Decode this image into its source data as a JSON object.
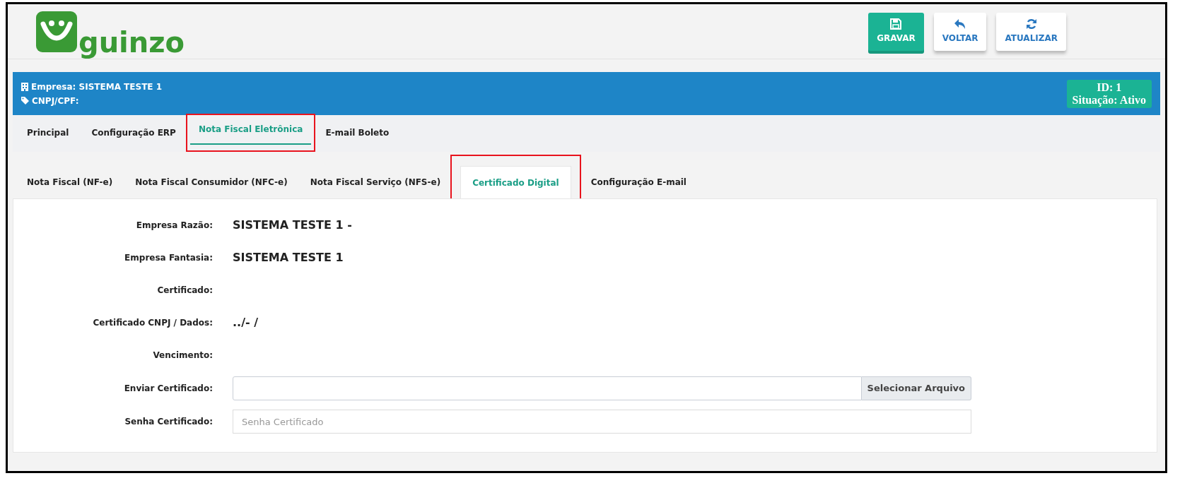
{
  "logo": {
    "text": "guinzo"
  },
  "toolbar": [
    {
      "label": "GRAVAR",
      "kind": "primary"
    },
    {
      "label": "VOLTAR",
      "kind": "default"
    },
    {
      "label": "ATUALIZAR",
      "kind": "default"
    }
  ],
  "company_bar": {
    "company": "Empresa: SISTEMA TESTE 1",
    "cnpj": "CNPJ/CPF:",
    "id": "ID: 1",
    "status": "Situação: Ativo"
  },
  "tabs": [
    {
      "label": "Principal",
      "selected": false,
      "highlighted": false
    },
    {
      "label": "Configuração ERP",
      "selected": false,
      "highlighted": false
    },
    {
      "label": "Nota Fiscal Eletrônica",
      "selected": true,
      "highlighted": true
    },
    {
      "label": "E-mail Boleto",
      "selected": false,
      "highlighted": false
    }
  ],
  "subtabs": [
    {
      "label": "Nota Fiscal (NF-e)",
      "selected": false,
      "highlighted": false
    },
    {
      "label": "Nota Fiscal Consumidor (NFC-e)",
      "selected": false,
      "highlighted": false
    },
    {
      "label": "Nota Fiscal Serviço (NFS-e)",
      "selected": false,
      "highlighted": false
    },
    {
      "label": "Certificado Digital",
      "selected": true,
      "highlighted": true
    },
    {
      "label": "Configuração E-mail",
      "selected": false,
      "highlighted": false
    }
  ],
  "form": [
    {
      "kind": "text",
      "label": "Empresa Razão:",
      "value": "SISTEMA TESTE 1 -"
    },
    {
      "kind": "text",
      "label": "Empresa Fantasia:",
      "value": "SISTEMA TESTE 1"
    },
    {
      "kind": "text",
      "label": "Certificado:"
    },
    {
      "kind": "text",
      "label": "Certificado CNPJ / Dados:",
      "value": "../- /"
    },
    {
      "kind": "text",
      "label": "Vencimento:"
    },
    {
      "kind": "file",
      "label": "Enviar Certificado:",
      "button": "Selecionar Arquivo"
    },
    {
      "kind": "input",
      "label": "Senha Certificado:",
      "placeholder": "Senha Certificado"
    }
  ]
}
